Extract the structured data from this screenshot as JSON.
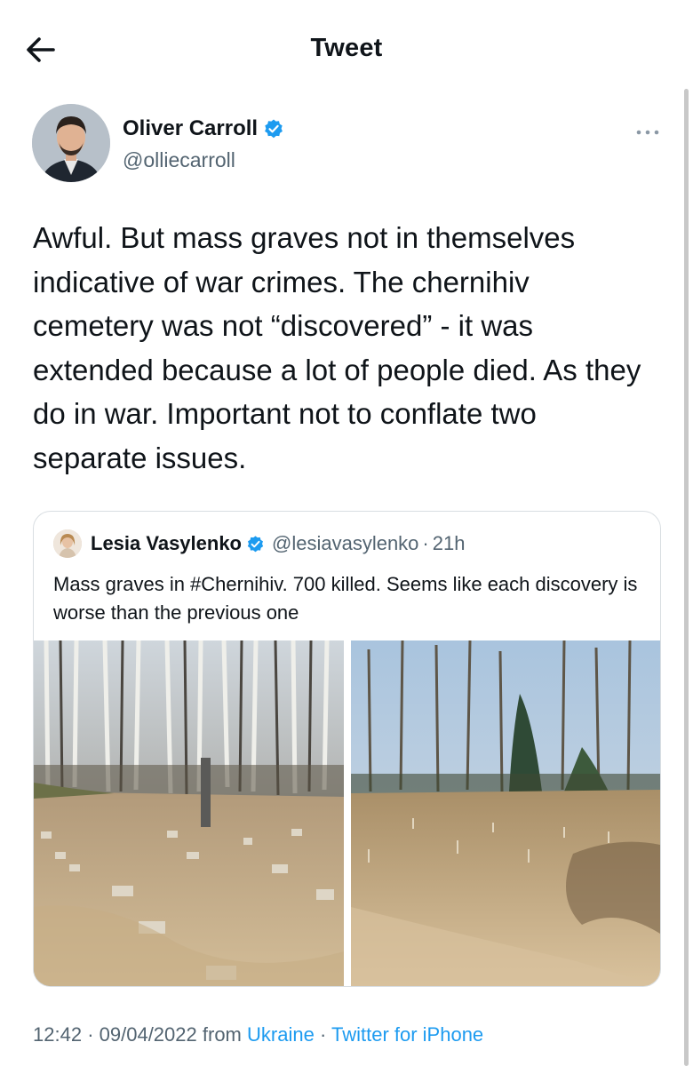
{
  "header": {
    "title": "Tweet",
    "back_icon": "arrow-left-icon"
  },
  "tweet": {
    "author_name": "Oliver Carroll",
    "author_handle": "@olliecarroll",
    "verified": true,
    "text": "Awful. But mass graves not in themselves indicative of war crimes. The chernihiv cemetery was not “discovered” - it was extended because a lot of people died. As they do in war. Important not to conflate two separate issues.",
    "time": "12:42",
    "date": "09/04/2022",
    "from_label": "from",
    "location": "Ukraine",
    "client": "Twitter for iPhone",
    "separator": "·"
  },
  "quoted_tweet": {
    "author_name": "Lesia Vasylenko",
    "author_handle": "@lesiavasylenko",
    "verified": true,
    "separator": "·",
    "time_ago": "21h",
    "text": "Mass graves in #Chernihiv. 700 killed. Seems like each discovery is worse than the previous one",
    "images": [
      {
        "name": "grave-site-photo-1"
      },
      {
        "name": "grave-site-photo-2"
      }
    ]
  },
  "colors": {
    "text": "#0f1419",
    "secondary": "#536471",
    "link": "#1d9bf0",
    "verified": "#1d9bf0",
    "border": "#d9dee2"
  }
}
